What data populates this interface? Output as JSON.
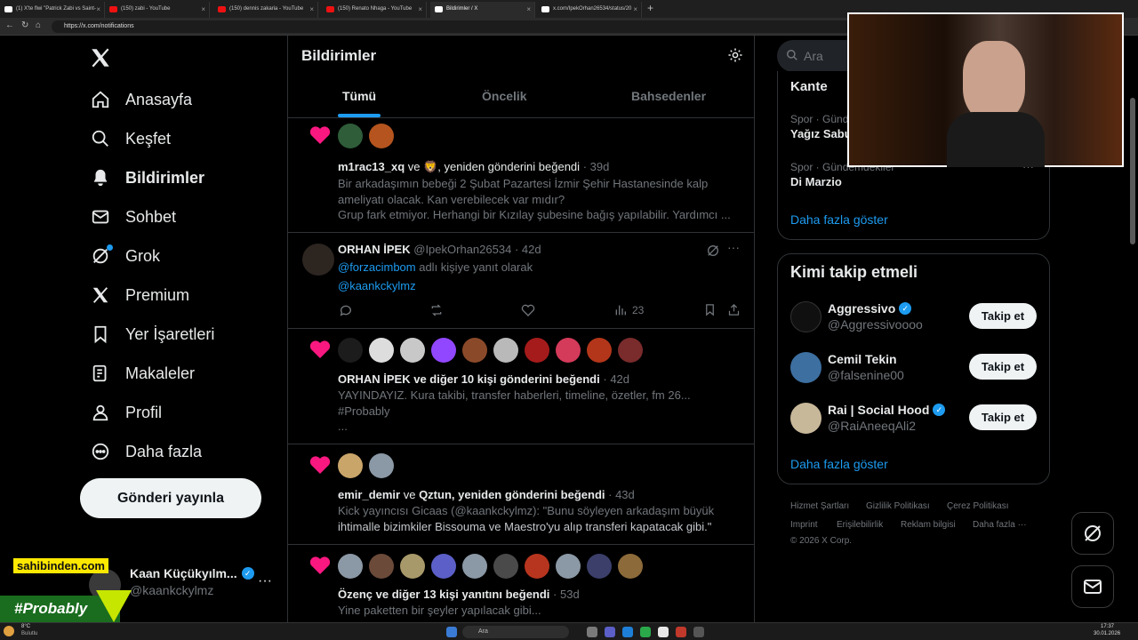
{
  "browser": {
    "tabs": [
      {
        "title": "(1) X'te flwi \"Patrick Zabi vs Saint-"
      },
      {
        "title": "(150) zabi - YouTube"
      },
      {
        "title": "(150) dennis zakaria - YouTube"
      },
      {
        "title": "(150) Renato Nhaga - YouTube"
      },
      {
        "title": "Bildirimler / X"
      },
      {
        "title": "x.com/IpekOrhan26534/status/20"
      }
    ],
    "url": "https://x.com/notifications"
  },
  "nav": {
    "items": [
      {
        "label": "Anasayfa",
        "icon": "home-icon"
      },
      {
        "label": "Keşfet",
        "icon": "search-icon"
      },
      {
        "label": "Bildirimler",
        "icon": "bell-icon"
      },
      {
        "label": "Sohbet",
        "icon": "mail-icon"
      },
      {
        "label": "Grok",
        "icon": "grok-icon"
      },
      {
        "label": "Premium",
        "icon": "x-logo-icon"
      },
      {
        "label": "Yer İşaretleri",
        "icon": "bookmark-icon"
      },
      {
        "label": "Makaleler",
        "icon": "article-icon"
      },
      {
        "label": "Profil",
        "icon": "person-icon"
      },
      {
        "label": "Daha fazla",
        "icon": "more-circle-icon"
      }
    ],
    "post_button": "Gönderi yayınla"
  },
  "account": {
    "name": "Kaan Küçükyılm...",
    "handle": "@kaankckylmz"
  },
  "overlay": {
    "sponsor": "sahibinden.com",
    "hashtag": "#Probably"
  },
  "main": {
    "title": "Bildirimler",
    "tabs": [
      "Tümü",
      "Öncelik",
      "Bahsedenler"
    ],
    "notifications": [
      {
        "actor": "m1rac13_xq",
        "rest": " ve 🦁, yeniden gönderini beğendi",
        "time": "· 39d",
        "lines": [
          "Bir arkadaşımın bebeği 2 Şubat Pazartesi İzmir Şehir Hastanesinde kalp",
          "ameliyatı olacak. Kan verebilecek var mıdır?",
          "Grup fark etmiyor. Herhangi bir Kızılay şubesine bağış yapılabilir. Yardımcı ..."
        ]
      },
      {
        "name": "ORHAN İPEK",
        "handle": "@IpekOrhan26534",
        "time": "· 42d",
        "reply_to": "@forzacimbom",
        "reply_suffix": " adlı kişiye yanıt olarak",
        "body": "@kaankckylmz",
        "views": "23"
      },
      {
        "actor": "ORHAN İPEK",
        "rest": " ve diğer 10 kişi gönderini beğendi",
        "time": "· 42d",
        "lines": [
          "YAYINDAYIZ. Kura takibi, transfer haberleri, timeline, özetler, fm 26...",
          "#Probably",
          "..."
        ]
      },
      {
        "actor": "emir_demir",
        "mid": " ve ",
        "actor2": "Qztun",
        "rest": ", yeniden gönderini beğendi",
        "time": "· 43d",
        "lines": [
          "Kick yayıncısı Gicaas (@kaankckylmz): \"Bunu söyleyen arkadaşım büyük",
          "ihtimalle bizimkiler Bissouma ve Maestro'yu alıp transferi kapatacak gibi.\""
        ]
      },
      {
        "actor": "Özenç",
        "rest": " ve diğer 13 kişi yanıtını beğendi",
        "time": "· 53d",
        "lines": [
          "Yine paketten bir şeyler yapılacak gibi..."
        ]
      }
    ]
  },
  "right": {
    "search_placeholder": "Ara",
    "trends": [
      {
        "title": "Kante"
      },
      {
        "category": "Spor · Gündem",
        "title": "Yağız Sabu"
      },
      {
        "category": "Spor · Gündemdekiler",
        "title": "Di Marzio"
      }
    ],
    "trends_more": "Daha fazla göster",
    "who_title": "Kimi takip etmeli",
    "who": [
      {
        "name": "Aggressivo",
        "handle": "@Aggressivoooo",
        "verified": true,
        "button": "Takip et"
      },
      {
        "name": "Cemil Tekin",
        "handle": "@falsenine00",
        "verified": false,
        "button": "Takip et"
      },
      {
        "name": "Rai | Social Hood",
        "handle": "@RaiAneeqAli2",
        "verified": true,
        "button": "Takip et"
      }
    ],
    "who_more": "Daha fazla göster",
    "footer": [
      "Hizmet Şartları",
      "Gizlilik Politikası",
      "Çerez Politikası",
      "Imprint",
      "Erişilebilirlik",
      "Reklam bilgisi",
      "Daha fazla ···",
      "© 2026 X Corp."
    ]
  },
  "taskbar": {
    "weather_temp": "8°C",
    "weather_desc": "Bulutlu",
    "search": "Ara",
    "time": "17:37",
    "date": "30.01.2026"
  }
}
